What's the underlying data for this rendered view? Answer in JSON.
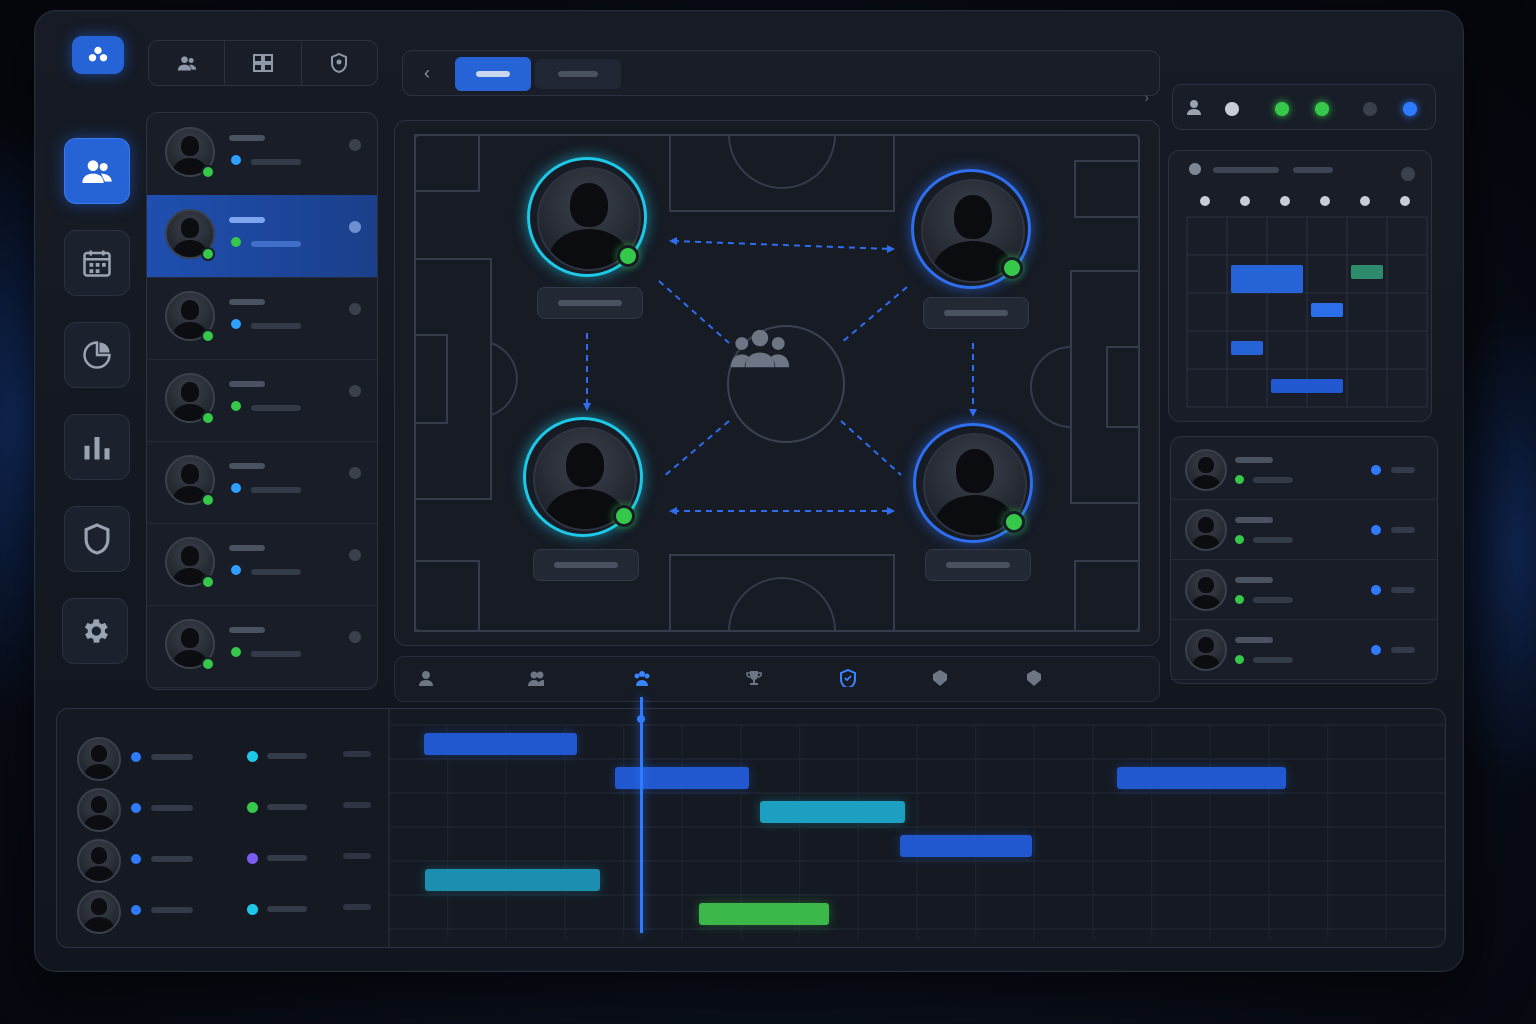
{
  "colors": {
    "accent": "#2563d6",
    "online": "#35c84a",
    "teal": "#1ea0c8",
    "purple": "#7b5cf0",
    "bar_blue": "#2158d0",
    "bar_teal": "#1c9fc0",
    "bar_green": "#3cb84a"
  },
  "logo": {
    "icon": "team-logo-icon"
  },
  "toolbar": {
    "buttons": [
      {
        "name": "users-tool",
        "icon": "users-icon"
      },
      {
        "name": "layout-tool",
        "icon": "grid-icon"
      },
      {
        "name": "shield-tool",
        "icon": "shield-icon"
      }
    ]
  },
  "tabs": {
    "active_tab": "tab-1",
    "inactive_tab": "tab-2"
  },
  "status_indicators": [
    "user",
    "grey",
    "green",
    "green",
    "dark",
    "blue"
  ],
  "sidebar": {
    "items": [
      {
        "name": "team",
        "icon": "users-icon",
        "active": true
      },
      {
        "name": "calendar",
        "icon": "calendar-icon",
        "active": false
      },
      {
        "name": "reports",
        "icon": "pie-chart-icon",
        "active": false
      },
      {
        "name": "stats",
        "icon": "bar-chart-icon",
        "active": false
      },
      {
        "name": "security",
        "icon": "shield-icon",
        "active": false
      },
      {
        "name": "settings",
        "icon": "gear-icon",
        "active": false
      }
    ]
  },
  "roster": {
    "rows": [
      {
        "status_color": "#2ea0ff",
        "selected": false
      },
      {
        "status_color": "#35c84a",
        "selected": true
      },
      {
        "status_color": "#2ea0ff",
        "selected": false
      },
      {
        "status_color": "#35c84a",
        "selected": false
      },
      {
        "status_color": "#2ea0ff",
        "selected": false
      },
      {
        "status_color": "#2ea0ff",
        "selected": false
      },
      {
        "status_color": "#35c84a",
        "selected": false
      }
    ]
  },
  "formation": {
    "players": [
      "top-left",
      "top-right",
      "bottom-left",
      "bottom-right"
    ],
    "hub_icon": "team-group-icon"
  },
  "schedule_events": [
    {
      "row": 2,
      "col_start": 1,
      "col_end": 3,
      "color": "#2563d6"
    },
    {
      "row": 2,
      "col_start": 4,
      "col_end": 5,
      "color": "#2d8a6a"
    },
    {
      "row": 3,
      "col_start": 3,
      "col_end": 4,
      "color": "#2a6fe8"
    },
    {
      "row": 4,
      "col_start": 1,
      "col_end": 2,
      "color": "#2563d6"
    },
    {
      "row": 5,
      "col_start": 2,
      "col_end": 4,
      "color": "#2158d0"
    }
  ],
  "member_list": [
    "m1",
    "m2",
    "m3",
    "m4"
  ],
  "icon_strip": [
    {
      "icon": "user-icon",
      "active": false
    },
    {
      "icon": "users-icon",
      "active": false
    },
    {
      "icon": "team-group-icon",
      "active": true
    },
    {
      "icon": "trophy-icon",
      "active": false
    },
    {
      "icon": "shield-icon",
      "active": true
    },
    {
      "icon": "badge-icon",
      "active": false
    },
    {
      "icon": "badge-icon",
      "active": false
    }
  ],
  "timeline": {
    "rows": [
      {
        "dot_a": "#2e7bff",
        "dot_b": "#1ec8e8"
      },
      {
        "dot_a": "#2e7bff",
        "dot_b": "#35c84a"
      },
      {
        "dot_a": "#2e7bff",
        "dot_b": "#7b5cf0"
      },
      {
        "dot_a": "#2e7bff",
        "dot_b": "#1ec8e8"
      }
    ],
    "playhead_position": 0.238,
    "bars": [
      {
        "start": 0.033,
        "end": 0.178,
        "row": 0,
        "color": "#2158d0"
      },
      {
        "start": 0.214,
        "end": 0.341,
        "row": 1,
        "color": "#2158d0"
      },
      {
        "start": 0.689,
        "end": 0.849,
        "row": 1,
        "color": "#2158d0"
      },
      {
        "start": 0.351,
        "end": 0.489,
        "row": 2,
        "color": "#1c9fc0"
      },
      {
        "start": 0.484,
        "end": 0.609,
        "row": 3,
        "color": "#2158d0"
      },
      {
        "start": 0.034,
        "end": 0.2,
        "row": 4,
        "color": "#1c8fb0"
      },
      {
        "start": 0.294,
        "end": 0.417,
        "row": 5,
        "color": "#3cb84a"
      }
    ]
  }
}
